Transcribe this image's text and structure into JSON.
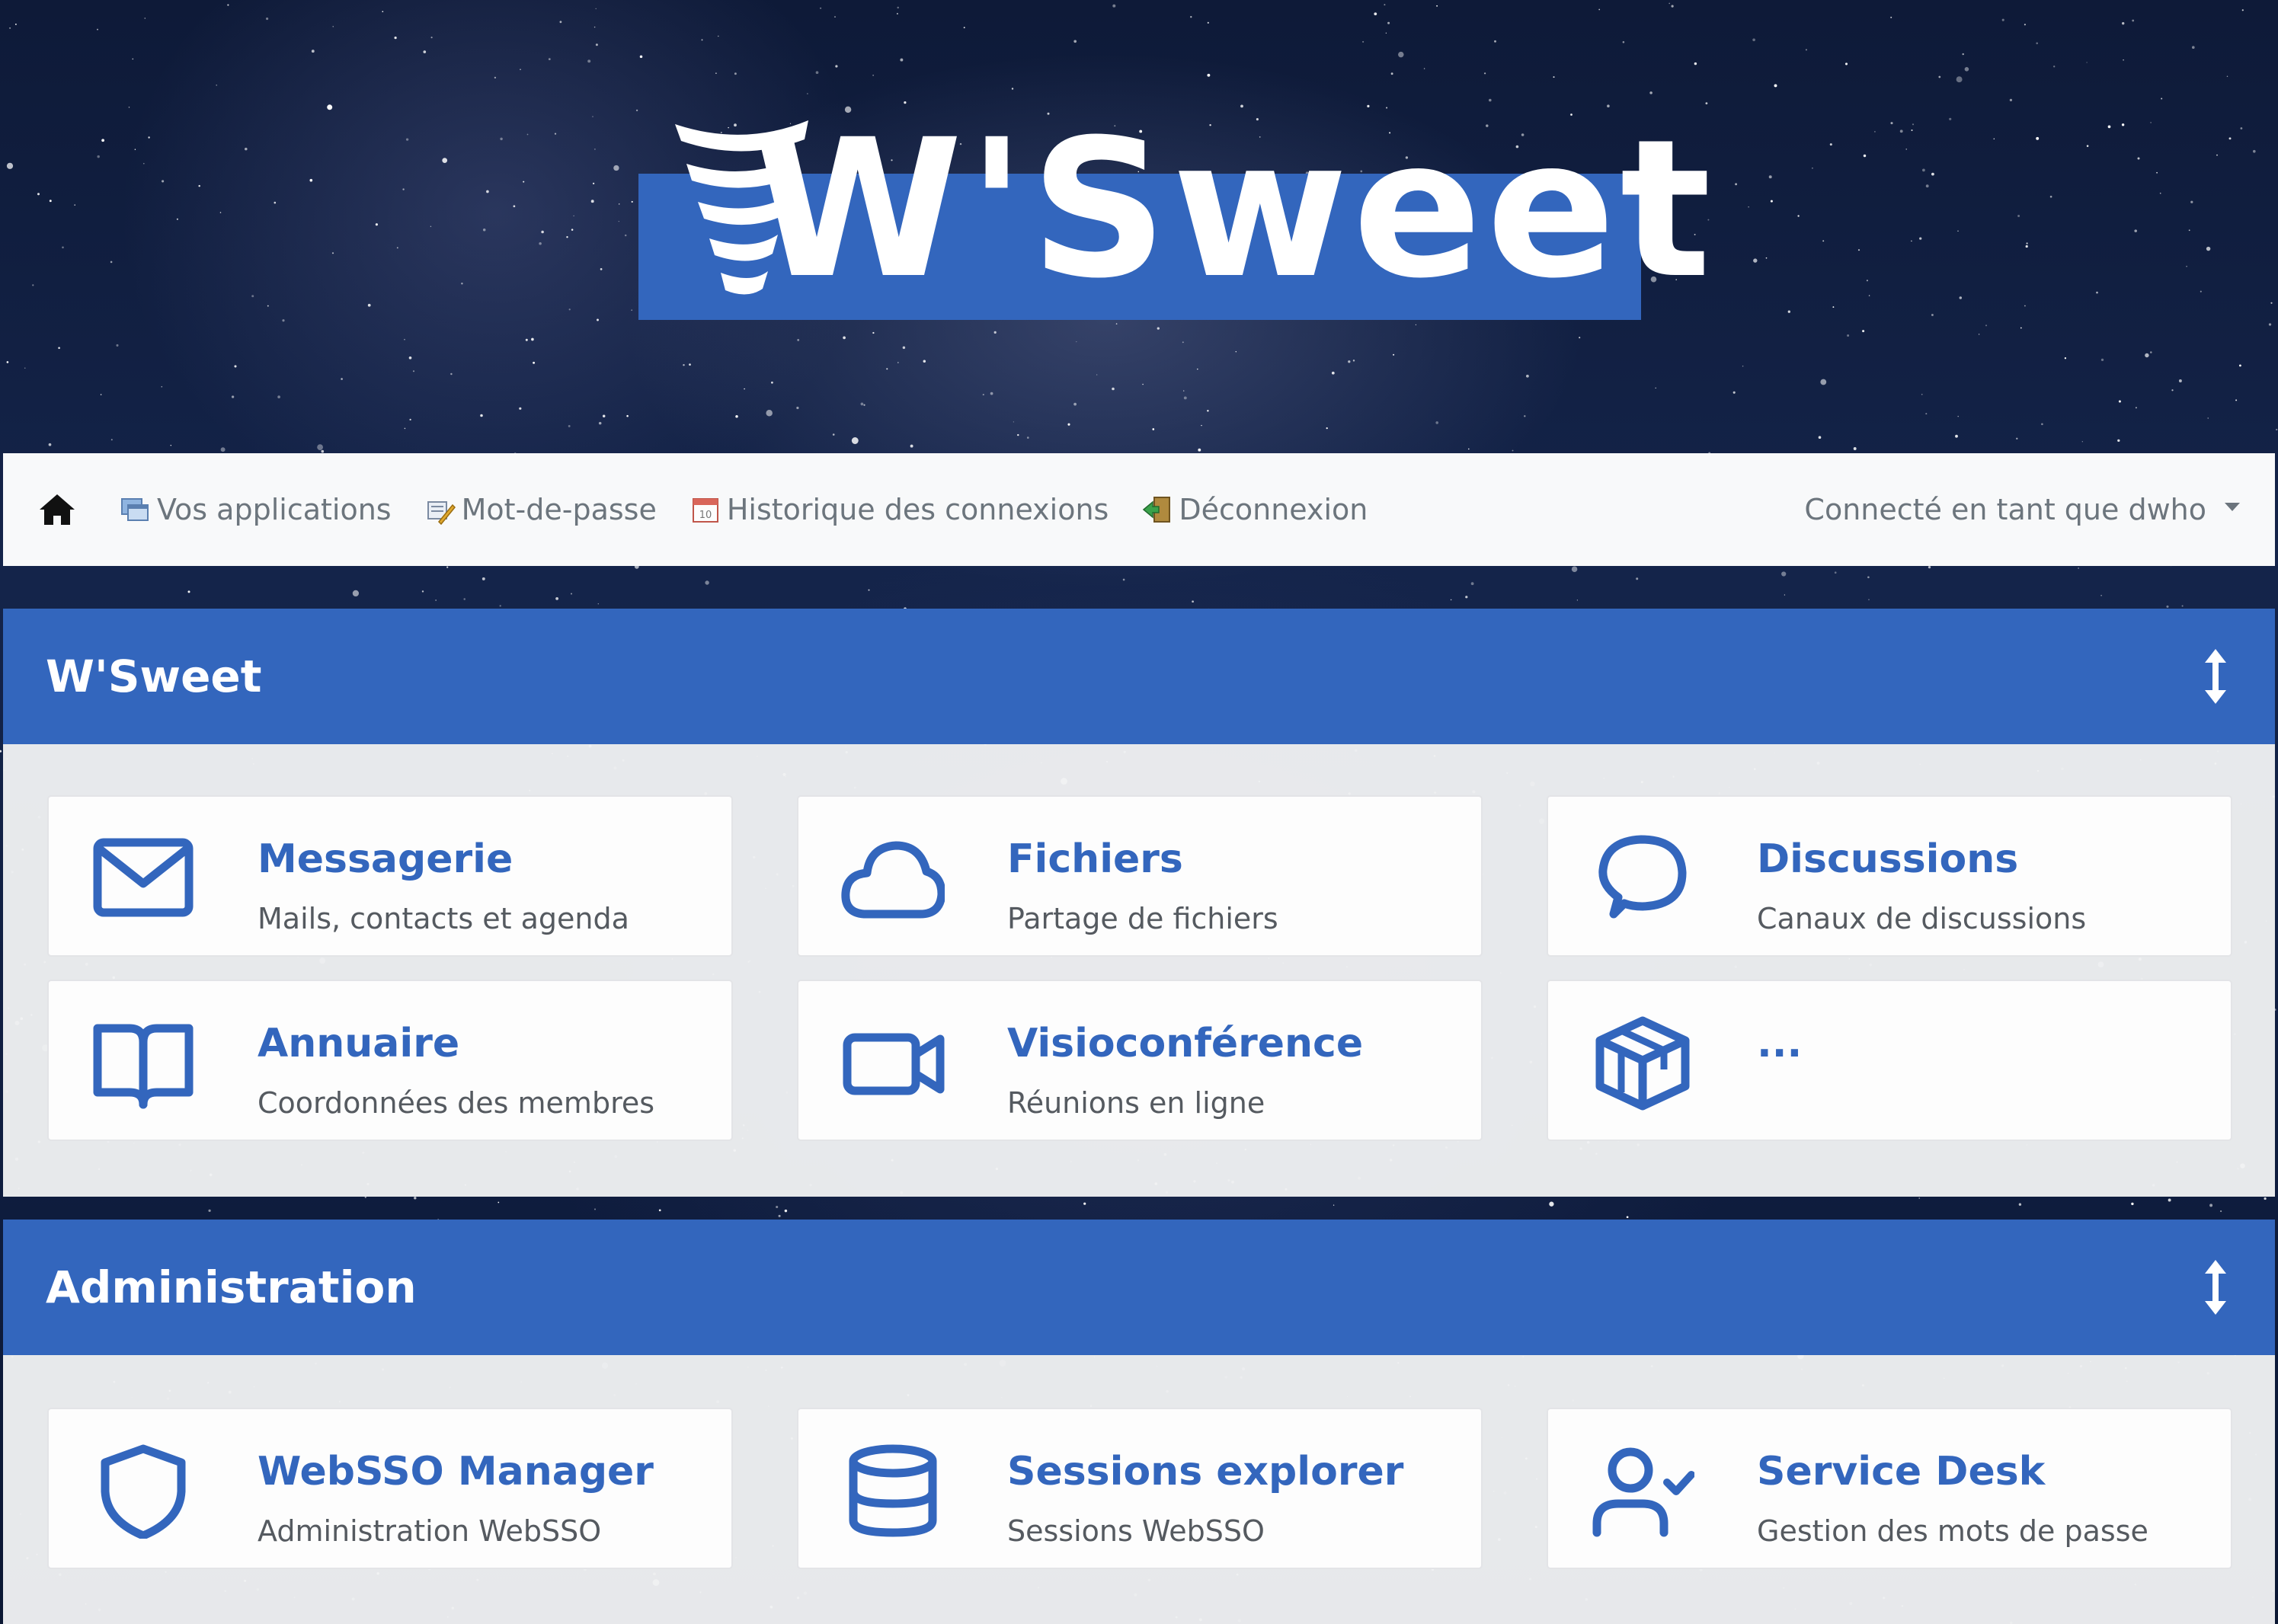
{
  "brand": {
    "logo_text": "W'Sweet",
    "color": "#3366bd"
  },
  "navbar": {
    "home_icon": "home-icon",
    "items": [
      {
        "label": "Vos applications",
        "icon": "applications-icon"
      },
      {
        "label": "Mot-de-passe",
        "icon": "password-icon"
      },
      {
        "label": "Historique des connexions",
        "icon": "calendar-icon"
      },
      {
        "label": "Déconnexion",
        "icon": "logout-icon"
      }
    ],
    "user": "Connecté en tant que dwho"
  },
  "categories": [
    {
      "title": "W'Sweet",
      "apps": [
        {
          "name": "Messagerie",
          "description": "Mails, contacts et agenda",
          "icon": "mail-icon"
        },
        {
          "name": "Fichiers",
          "description": "Partage de fichiers",
          "icon": "cloud-icon"
        },
        {
          "name": "Discussions",
          "description": "Canaux de discussions",
          "icon": "chat-icon"
        },
        {
          "name": "Annuaire",
          "description": "Coordonnées des membres",
          "icon": "book-icon"
        },
        {
          "name": "Visioconférence",
          "description": "Réunions en ligne",
          "icon": "video-icon"
        },
        {
          "name": "...",
          "description": "",
          "icon": "box-icon"
        }
      ]
    },
    {
      "title": "Administration",
      "apps": [
        {
          "name": "WebSSO Manager",
          "description": "Administration WebSSO",
          "icon": "shield-icon"
        },
        {
          "name": "Sessions explorer",
          "description": "Sessions WebSSO",
          "icon": "database-icon"
        },
        {
          "name": "Service Desk",
          "description": "Gestion des mots de passe",
          "icon": "user-check-icon"
        }
      ]
    }
  ]
}
